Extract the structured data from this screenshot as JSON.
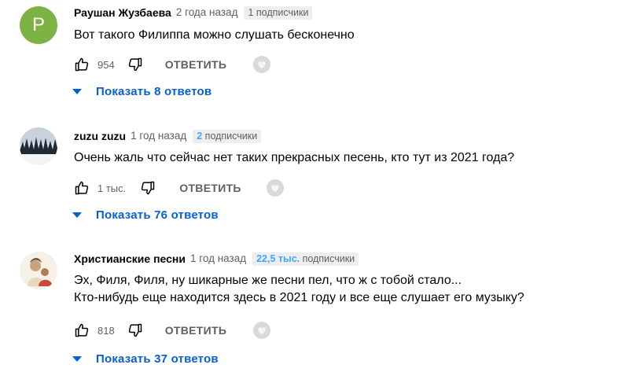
{
  "comments": [
    {
      "avatar_letter": "P",
      "author": "Раушан Жузбаева",
      "time": "2 года назад",
      "subs_count": "1",
      "subs_label": "подписчики",
      "text_lines": [
        "Вот такого Филиппа можно слушать бесконечно"
      ],
      "likes": "954",
      "reply_label": "ОТВЕТИТЬ",
      "replies_label": "Показать 8 ответов"
    },
    {
      "author": "zuzu zuzu",
      "time": "1 год назад",
      "subs_count": "2",
      "subs_label": "подписчики",
      "text_lines": [
        "Очень жаль что сейчас нет таких прекрасных песень, кто тут из 2021 года?"
      ],
      "likes": "1 тыс.",
      "reply_label": "ОТВЕТИТЬ",
      "replies_label": "Показать 76 ответов"
    },
    {
      "author": "Христианские песни",
      "time": "1 год назад",
      "subs_count": "22,5 тыс.",
      "subs_label": "подписчики",
      "text_lines": [
        "Эх, Филя, Филя, ну шикарные же песни пел, что ж с тобой стало...",
        "Кто-нибудь еще находится здесь в 2021 году и все еще слушает его музыку?"
      ],
      "likes": "818",
      "reply_label": "ОТВЕТИТЬ",
      "replies_label": "Показать 37 ответов"
    }
  ],
  "colors": {
    "link_blue": "#065fd4",
    "secondary_text": "#606060",
    "avatar_green": "#7cb342",
    "badge_bg": "#eeeeee"
  },
  "icons": [
    "thumbs-up-icon",
    "thumbs-down-icon",
    "creator-heart-icon",
    "chevron-down-icon"
  ]
}
